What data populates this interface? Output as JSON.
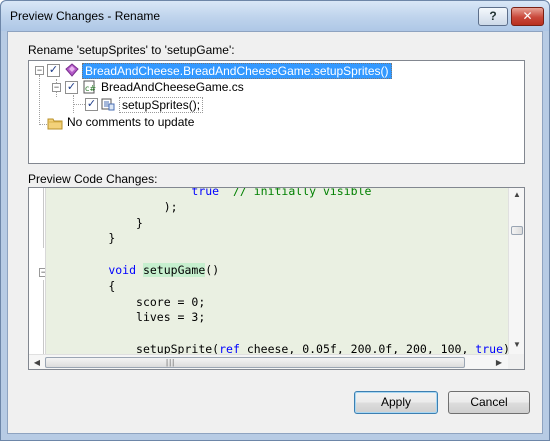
{
  "window": {
    "title": "Preview Changes - Rename",
    "help_label": "?",
    "close_label": "✕"
  },
  "rename_label": "Rename 'setupSprites' to 'setupGame':",
  "tree": {
    "root_label": "BreadAndCheese.BreadAndCheeseGame.setupSprites()",
    "file_label": "BreadAndCheeseGame.cs",
    "method_label": "setupSprites();",
    "comments_label": "No comments to update"
  },
  "preview_label": "Preview Code Changes:",
  "code": {
    "lines": [
      {
        "indent": "            ",
        "parts": [
          {
            "t": "true",
            "c": "kw"
          },
          {
            "t": "  // initially visible",
            "c": "cm"
          }
        ]
      },
      {
        "indent": "        ",
        "parts": [
          {
            "t": ");",
            "c": ""
          }
        ]
      },
      {
        "indent": "    ",
        "parts": [
          {
            "t": "}",
            "c": ""
          }
        ]
      },
      {
        "indent": "",
        "parts": [
          {
            "t": "}",
            "c": ""
          }
        ]
      },
      {
        "indent": "",
        "parts": []
      },
      {
        "indent": "",
        "parts": [
          {
            "t": "void",
            "c": "kw"
          },
          {
            "t": " ",
            "c": ""
          },
          {
            "t": "setupGame",
            "c": "hl"
          },
          {
            "t": "()",
            "c": ""
          }
        ]
      },
      {
        "indent": "",
        "parts": [
          {
            "t": "{",
            "c": ""
          }
        ]
      },
      {
        "indent": "    ",
        "parts": [
          {
            "t": "score = 0;",
            "c": ""
          }
        ]
      },
      {
        "indent": "    ",
        "parts": [
          {
            "t": "lives = 3;",
            "c": ""
          }
        ]
      },
      {
        "indent": "",
        "parts": []
      },
      {
        "indent": "    ",
        "parts": [
          {
            "t": "setupSprite(",
            "c": ""
          },
          {
            "t": "ref",
            "c": "kw"
          },
          {
            "t": " cheese, 0.05f, 200.0f, 200, 100, ",
            "c": ""
          },
          {
            "t": "true",
            "c": "kw"
          },
          {
            "t": ");",
            "c": ""
          }
        ]
      }
    ]
  },
  "buttons": {
    "apply": "Apply",
    "cancel": "Cancel"
  },
  "colors": {
    "selection": "#3399ff",
    "keyword": "#0000ff",
    "comment": "#008000",
    "rename_highlight": "#c6efce",
    "code_background": "#eaf0e2"
  }
}
